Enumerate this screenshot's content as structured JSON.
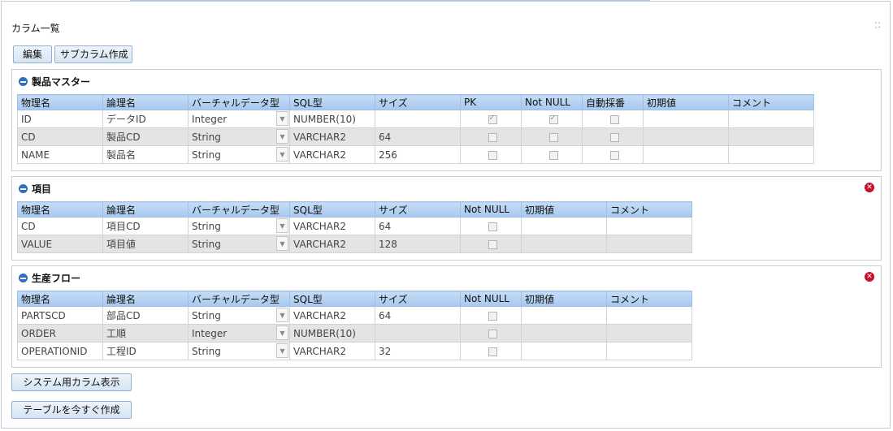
{
  "panel": {
    "title": "カラム一覧"
  },
  "toolbar": {
    "edit_label": "編集",
    "subcolumn_label": "サブカラム作成"
  },
  "bottom": {
    "system_columns_label": "システム用カラム表示",
    "create_table_label": "テーブルを今すぐ作成"
  },
  "sections": [
    {
      "title": "製品マスター",
      "headers": [
        "物理名",
        "論理名",
        "バーチャルデータ型",
        "SQL型",
        "サイズ",
        "PK",
        "Not NULL",
        "自動採番",
        "初期値",
        "コメント"
      ],
      "rows": [
        [
          "ID",
          "データID",
          "Integer",
          "NUMBER(10)",
          "",
          true,
          true,
          false,
          "",
          ""
        ],
        [
          "CD",
          "製品CD",
          "String",
          "VARCHAR2",
          "64",
          false,
          false,
          false,
          "",
          ""
        ],
        [
          "NAME",
          "製品名",
          "String",
          "VARCHAR2",
          "256",
          false,
          false,
          false,
          "",
          ""
        ]
      ]
    },
    {
      "title": "項目",
      "headers": [
        "物理名",
        "論理名",
        "バーチャルデータ型",
        "SQL型",
        "サイズ",
        "Not NULL",
        "初期値",
        "コメント"
      ],
      "rows": [
        [
          "CD",
          "項目CD",
          "String",
          "VARCHAR2",
          "64",
          false,
          "",
          ""
        ],
        [
          "VALUE",
          "項目値",
          "String",
          "VARCHAR2",
          "128",
          false,
          "",
          ""
        ]
      ]
    },
    {
      "title": "生産フロー",
      "headers": [
        "物理名",
        "論理名",
        "バーチャルデータ型",
        "SQL型",
        "サイズ",
        "Not NULL",
        "初期値",
        "コメント"
      ],
      "rows": [
        [
          "PARTSCD",
          "部品CD",
          "String",
          "VARCHAR2",
          "64",
          false,
          "",
          ""
        ],
        [
          "ORDER",
          "工順",
          "Integer",
          "NUMBER(10)",
          "",
          false,
          "",
          ""
        ],
        [
          "OPERATIONID",
          "工程ID",
          "String",
          "VARCHAR2",
          "32",
          false,
          "",
          ""
        ]
      ]
    }
  ]
}
